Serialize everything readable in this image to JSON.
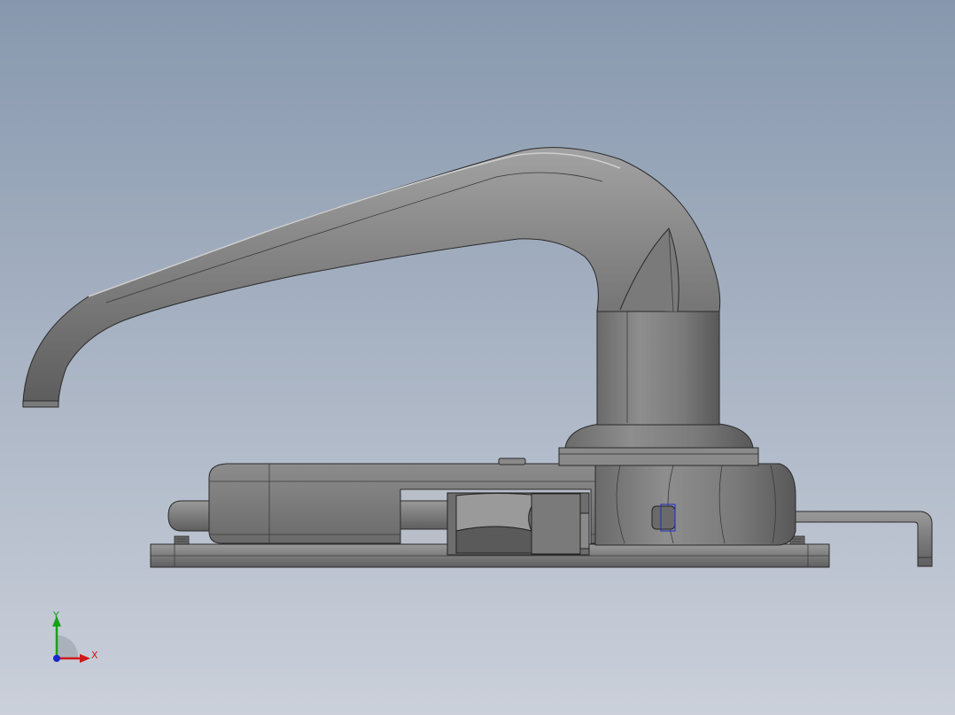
{
  "viewport": {
    "background_top": "#8a9bb0",
    "background_bottom": "#c9ced8",
    "part_color": "#8a8a8a",
    "edge_color": "#2e2e2e"
  },
  "triad": {
    "x_label": "X",
    "y_label": "Y",
    "x_color": "#d01818",
    "y_color": "#18a018",
    "z_color": "#1a28c8"
  },
  "model": {
    "icons": [
      "lever-handle",
      "spindle-rosette",
      "lock-body",
      "latch-bolt",
      "latch-bar",
      "mounting-plate"
    ]
  }
}
